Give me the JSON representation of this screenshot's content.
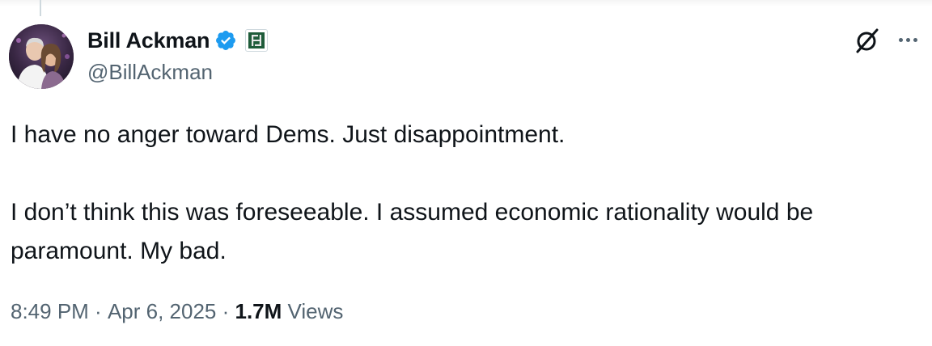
{
  "author": {
    "display_name": "Bill Ackman",
    "handle": "@BillAckman",
    "verified": true,
    "badge_color": "#1d9bf0"
  },
  "tweet": {
    "paragraphs": [
      "I have no anger toward Dems. Just disappointment.",
      "I don’t think this was foreseeable. I assumed economic rationality would be paramount. My bad."
    ]
  },
  "meta": {
    "time": "8:49 PM",
    "separator": " · ",
    "date": "Apr 6, 2025",
    "views_count": "1.7M",
    "views_label": "Views"
  },
  "icons": {
    "verified": "verified-badge-icon",
    "affiliate": "affiliate-logo-icon",
    "grok": "grok-icon",
    "more": "more-options-icon"
  }
}
